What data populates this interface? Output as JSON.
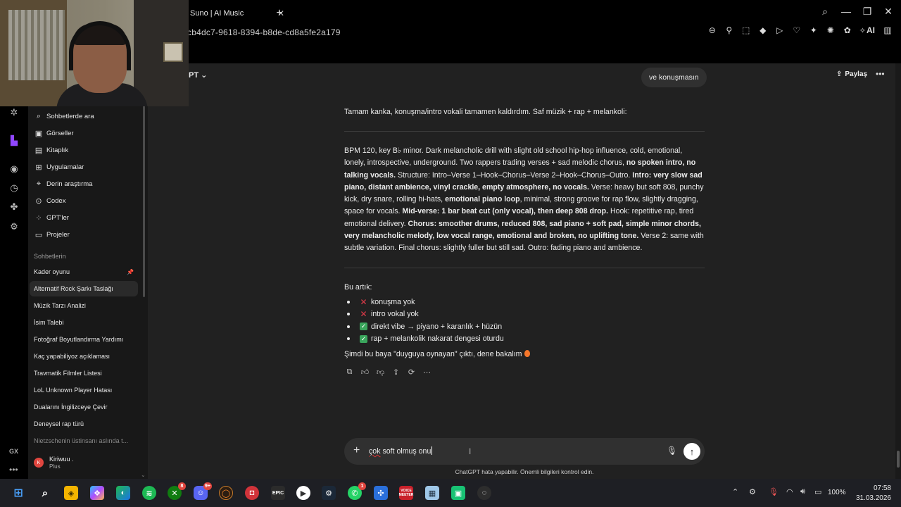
{
  "browser": {
    "tab_title": "Suno | AI Music",
    "url": "cb4dc7-9618-8394-b8de-cd8a5fe2a179",
    "ext_ai_label": "AI"
  },
  "header": {
    "model_name": "PT",
    "share_label": "Paylaş"
  },
  "sidebar": {
    "items": [
      {
        "label": "Sohbetlerde ara",
        "icon": "search-icon"
      },
      {
        "label": "Görseller",
        "icon": "image-icon"
      },
      {
        "label": "Kitaplık",
        "icon": "library-icon"
      },
      {
        "label": "Uygulamalar",
        "icon": "apps-icon"
      },
      {
        "label": "Derin araştırma",
        "icon": "telescope-icon"
      },
      {
        "label": "Codex",
        "icon": "code-icon"
      },
      {
        "label": "GPT'ler",
        "icon": "gpts-icon"
      },
      {
        "label": "Projeler",
        "icon": "folder-icon"
      }
    ],
    "section_label": "Sohbetlerin",
    "conversations": [
      "Kader oyunu",
      "Alternatif Rock Şarkı Taslağı",
      "Müzik Tarzı Analizi",
      "İsim Talebi",
      "Fotoğraf Boyutlandırma Yardımı",
      "Kaç yapabiliyoz açıklaması",
      "Travmatik Filmler Listesi",
      "LoL Unknown Player Hatası",
      "Dualarını İngilizceye Çevir",
      "Deneysel rap türü",
      "Nietzschenin üstinsanı aslında t..."
    ],
    "user": {
      "initial": "K",
      "name": "Kiriwuu .",
      "plan": "Plus"
    }
  },
  "chat": {
    "user_message": "ve konuşmasın",
    "intro": "Tamam kanka, konuşma/intro vokali tamamen kaldırdım. Saf müzik + rap + melankoli:",
    "prompt_segments": [
      {
        "t": "BPM 120, key B♭ minor. Dark melancholic drill with slight old school hip-hop influence, cold, emotional, lonely, introspective, underground. Two rappers trading verses + sad melodic chorus, ",
        "b": false
      },
      {
        "t": "no spoken intro, no talking vocals.",
        "b": true
      },
      {
        "t": " Structure: Intro–Verse 1–Hook–Chorus–Verse 2–Hook–Chorus–Outro. ",
        "b": false
      },
      {
        "t": "Intro: very slow sad piano, distant ambience, vinyl crackle, empty atmosphere, no vocals.",
        "b": true
      },
      {
        "t": " Verse: heavy but soft 808, punchy kick, dry snare, rolling hi-hats, ",
        "b": false
      },
      {
        "t": "emotional piano loop",
        "b": true
      },
      {
        "t": ", minimal, strong groove for rap flow, slightly dragging, space for vocals. ",
        "b": false
      },
      {
        "t": "Mid-verse: 1 bar beat cut (only vocal), then deep 808 drop.",
        "b": true
      },
      {
        "t": " Hook: repetitive rap, tired emotional delivery. ",
        "b": false
      },
      {
        "t": "Chorus: smoother drums, reduced 808, sad piano + soft pad, simple minor chords, very melancholic melody, low vocal range, emotional and broken, no uplifting tone.",
        "b": true
      },
      {
        "t": " Verse 2: same with subtle variation. Final chorus: slightly fuller but still sad. Outro: fading piano and ambience.",
        "b": false
      }
    ],
    "summary_label": "Bu artık:",
    "bullets": [
      {
        "mark": "x",
        "text": "konuşma yok"
      },
      {
        "mark": "x",
        "text": "intro vokal yok"
      },
      {
        "mark": "check",
        "text": "direkt vibe → piyano + karanlık + hüzün"
      },
      {
        "mark": "check",
        "text": "rap + melankolik nakarat dengesi oturdu"
      }
    ],
    "closing": "Şimdi bu baya \"duyguya oynayan\" çıktı, dene bakalım"
  },
  "composer": {
    "typo_word": "çok",
    "rest_text": " soft olmuş onu",
    "disclaimer": "ChatGPT hata yapabilir. Önemli bilgileri kontrol edin."
  },
  "taskbar": {
    "badges": {
      "xbox": "8",
      "discord": "9+",
      "whatsapp": "1"
    },
    "voicemeeter_label": "VOICE MEETER",
    "epic_label": "EPIC",
    "battery": "100%",
    "time": "07:58",
    "date": "31.03.2026"
  },
  "colors": {
    "accent_red": "#e0463f",
    "check_green": "#3aa55c",
    "main_bg": "#212121",
    "sidebar_bg": "#181818"
  }
}
